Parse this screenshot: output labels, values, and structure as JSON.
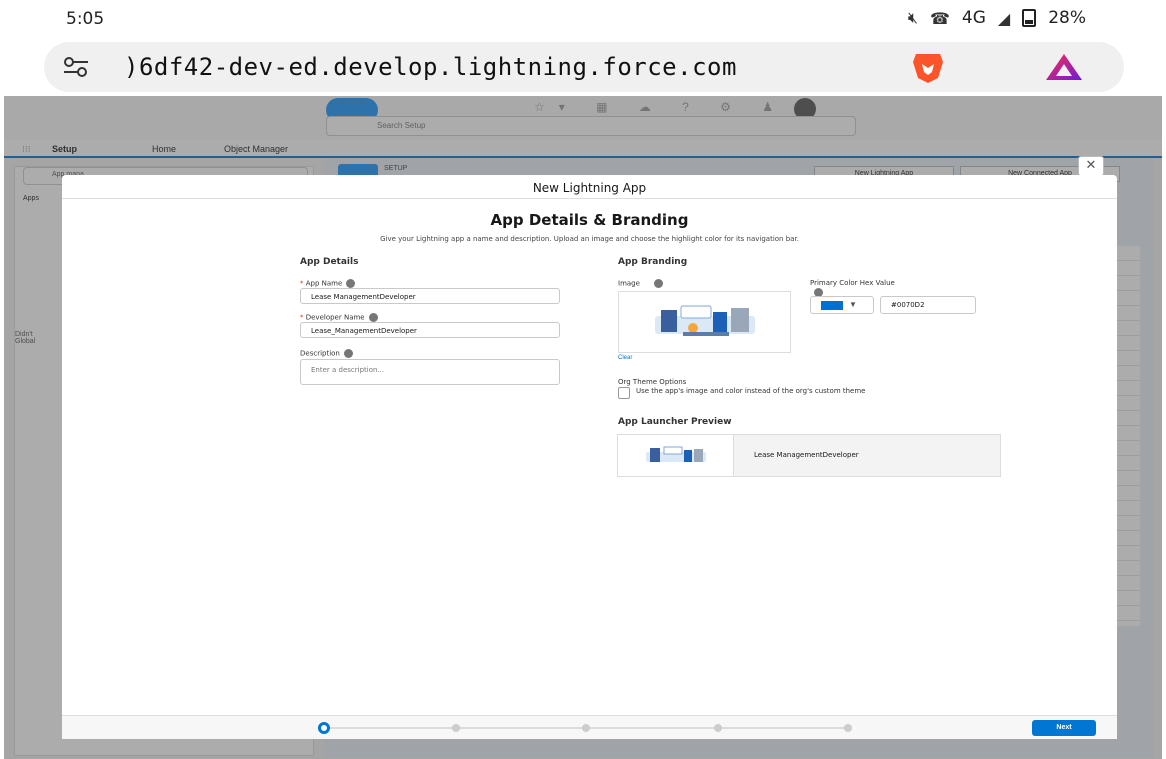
{
  "status_bar": {
    "time": "5:05",
    "network": "4G",
    "battery": "28%",
    "icons": [
      "mute-icon",
      "wifi-calling-icon",
      "signal-icon",
      "battery-icon"
    ]
  },
  "browser": {
    "url": ")6df42-dev-ed.develop.lightning.force.com",
    "icons": [
      "site-settings-icon",
      "brave-shield-icon",
      "brave-rewards-icon"
    ]
  },
  "salesforce": {
    "search_placeholder": "Search Setup",
    "nav": {
      "app_name": "Setup",
      "tabs": [
        "Home",
        "Object Manager"
      ]
    },
    "sidebar": {
      "search_value": "App mana",
      "tree_item": "Apps",
      "misc_text": [
        "Didn't",
        "Global"
      ]
    },
    "main": {
      "header_label": "SETUP",
      "buttons": [
        "New Lightning App",
        "New Connected App"
      ]
    }
  },
  "modal": {
    "title": "New Lightning App",
    "close_icon": "close-icon",
    "section_title": "App Details & Branding",
    "section_desc": "Give your Lightning app a name and description. Upload an image and choose the highlight color for its navigation bar.",
    "app_details": {
      "heading": "App Details",
      "app_name_label": "App Name",
      "app_name_value": "Lease ManagementDeveloper",
      "developer_name_label": "Developer Name",
      "developer_name_value": "Lease_ManagementDeveloper",
      "description_label": "Description",
      "description_placeholder": "Enter a description..."
    },
    "app_branding": {
      "heading": "App Branding",
      "image_label": "Image",
      "clear_link": "Clear",
      "primary_color_label": "Primary Color Hex Value",
      "primary_color_value": "#0070D2",
      "primary_color": "#0070d2",
      "org_theme_heading": "Org Theme Options",
      "org_theme_checkbox_label": "Use the app's image and color instead of the org's custom theme",
      "org_theme_checked": false
    },
    "launcher_preview": {
      "heading": "App Launcher Preview",
      "app_name": "Lease ManagementDeveloper"
    },
    "footer": {
      "steps_total": 5,
      "current_step": 1,
      "next_label": "Next"
    }
  },
  "colors": {
    "accent": "#0176d3",
    "brand_blue": "#1b96ff",
    "required": "#c23934"
  }
}
